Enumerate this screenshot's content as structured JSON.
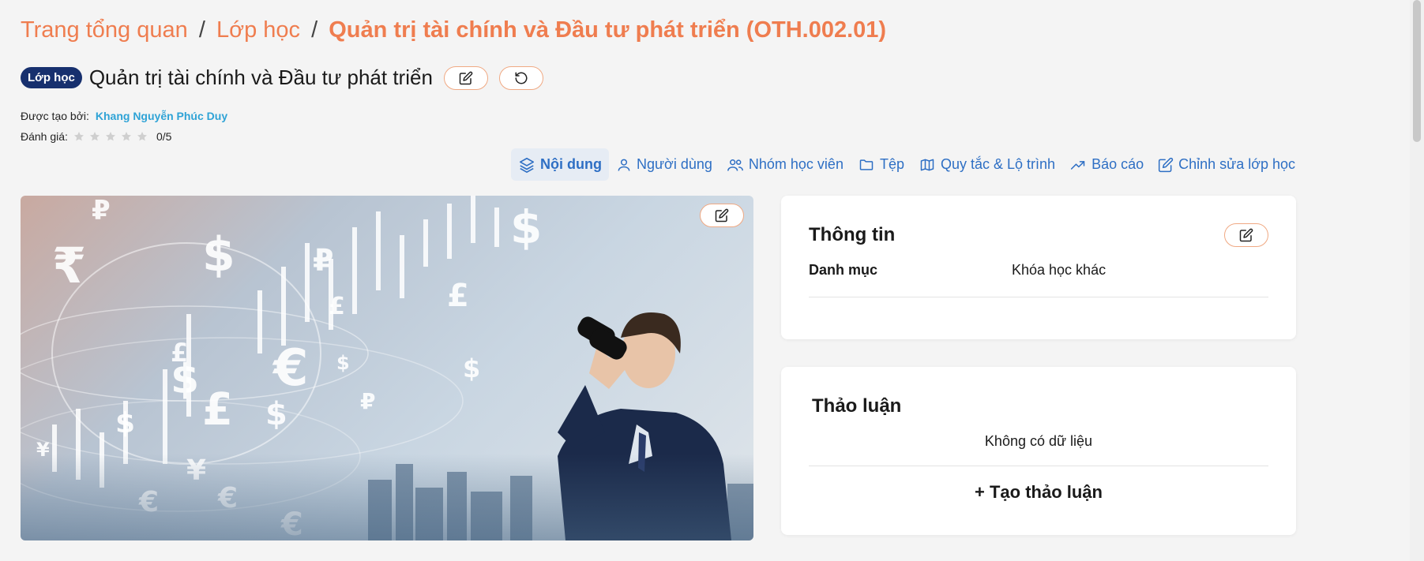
{
  "breadcrumb": {
    "items": [
      "Trang tổng quan",
      "Lớp học"
    ],
    "separator": "/",
    "current": "Quản trị tài chính và Đầu tư phát triển (OTH.002.01)"
  },
  "header": {
    "badge": "Lớp học",
    "title": "Quản trị tài chính và Đầu tư phát triển",
    "edit_icon": "edit-icon",
    "reset_icon": "reset-icon"
  },
  "meta": {
    "created_by_label": "Được tạo bởi:",
    "created_by": "Khang Nguyễn Phúc Duy",
    "rating_label": "Đánh giá:",
    "rating_value": "0/5",
    "rating": 0,
    "rating_max": 5
  },
  "tabs": [
    {
      "label": "Nội dung",
      "icon": "layers-icon",
      "active": true
    },
    {
      "label": "Người dùng",
      "icon": "user-icon",
      "active": false
    },
    {
      "label": "Nhóm học viên",
      "icon": "users-icon",
      "active": false
    },
    {
      "label": "Tệp",
      "icon": "folder-icon",
      "active": false
    },
    {
      "label": "Quy tắc & Lộ trình",
      "icon": "map-icon",
      "active": false
    },
    {
      "label": "Báo cáo",
      "icon": "trending-icon",
      "active": false
    },
    {
      "label": "Chỉnh sửa lớp học",
      "icon": "edit-icon",
      "active": false
    }
  ],
  "info_card": {
    "title": "Thông tin",
    "category_label": "Danh mục",
    "category_value": "Khóa học khác"
  },
  "discussion_card": {
    "title": "Thảo luận",
    "empty_text": "Không có dữ liệu",
    "create_label": "+ Tạo thảo luận"
  },
  "colors": {
    "accent": "#ef7d4f",
    "badge_bg": "#17306e",
    "link": "#2fa3d6",
    "tab": "#2e6fc4"
  }
}
